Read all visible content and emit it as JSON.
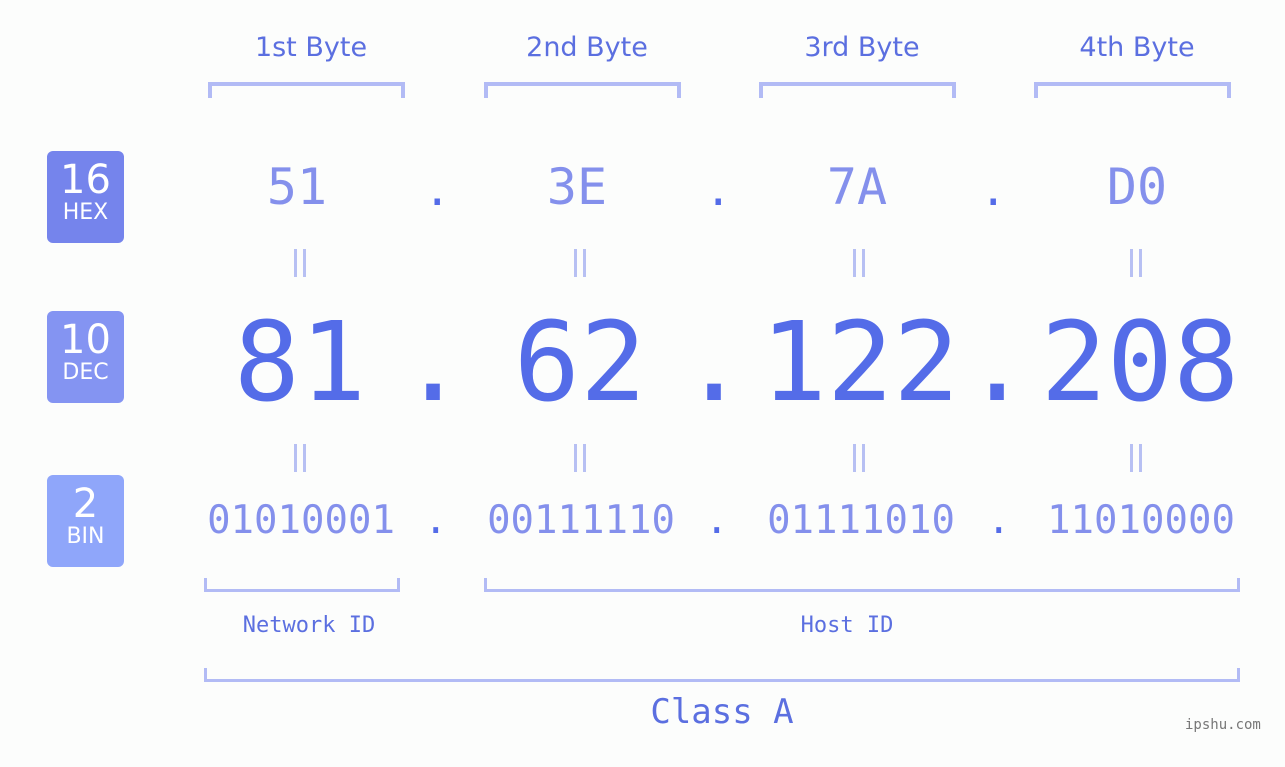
{
  "bytes": {
    "labels": [
      "1st Byte",
      "2nd Byte",
      "3rd Byte",
      "4th Byte"
    ]
  },
  "badges": {
    "hex": {
      "number": "16",
      "label": "HEX",
      "color": "#7584ec"
    },
    "dec": {
      "number": "10",
      "label": "DEC",
      "color": "#8494f2"
    },
    "bin": {
      "number": "2",
      "label": "BIN",
      "color": "#8fa6fa"
    }
  },
  "ip": {
    "hex": [
      "51",
      "3E",
      "7A",
      "D0"
    ],
    "dec": [
      "81",
      "62",
      "122",
      "208"
    ],
    "bin": [
      "01010001",
      "00111110",
      "01111010",
      "11010000"
    ],
    "separator": "."
  },
  "segments": {
    "network_id": "Network ID",
    "host_id": "Host ID",
    "class_label": "Class A"
  },
  "watermark": "ipshu.com",
  "colors": {
    "primary": "#546ce8",
    "secondary": "#8490ec",
    "bracket": "#b2bbf5",
    "background": "#fcfdfc"
  }
}
